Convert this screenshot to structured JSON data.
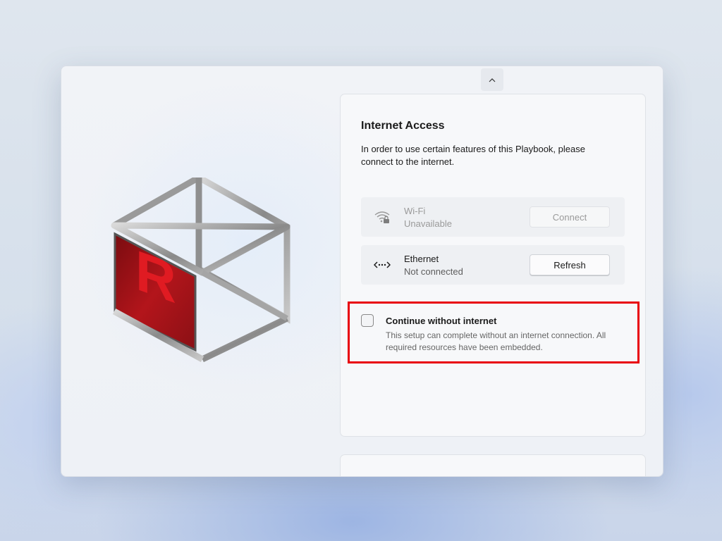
{
  "header": {
    "collapse_icon": "chevron-up-icon"
  },
  "logo": {
    "letter": "R",
    "icon": "cube-logo-icon"
  },
  "internet_card": {
    "title": "Internet Access",
    "description": "In order to use certain features of this Playbook, please connect to the internet.",
    "networks": [
      {
        "name": "Wi-Fi",
        "status": "Unavailable",
        "button_label": "Connect",
        "icon": "wifi-lock-icon",
        "enabled": false
      },
      {
        "name": "Ethernet",
        "status": "Not connected",
        "button_label": "Refresh",
        "icon": "ethernet-icon",
        "enabled": true
      }
    ],
    "continue_option": {
      "title": "Continue without internet",
      "description": "This setup can complete without an internet connection. All required resources have been embedded.",
      "checked": false
    }
  },
  "colors": {
    "highlight": "#e8000b",
    "logo_red": "#b3151b"
  }
}
